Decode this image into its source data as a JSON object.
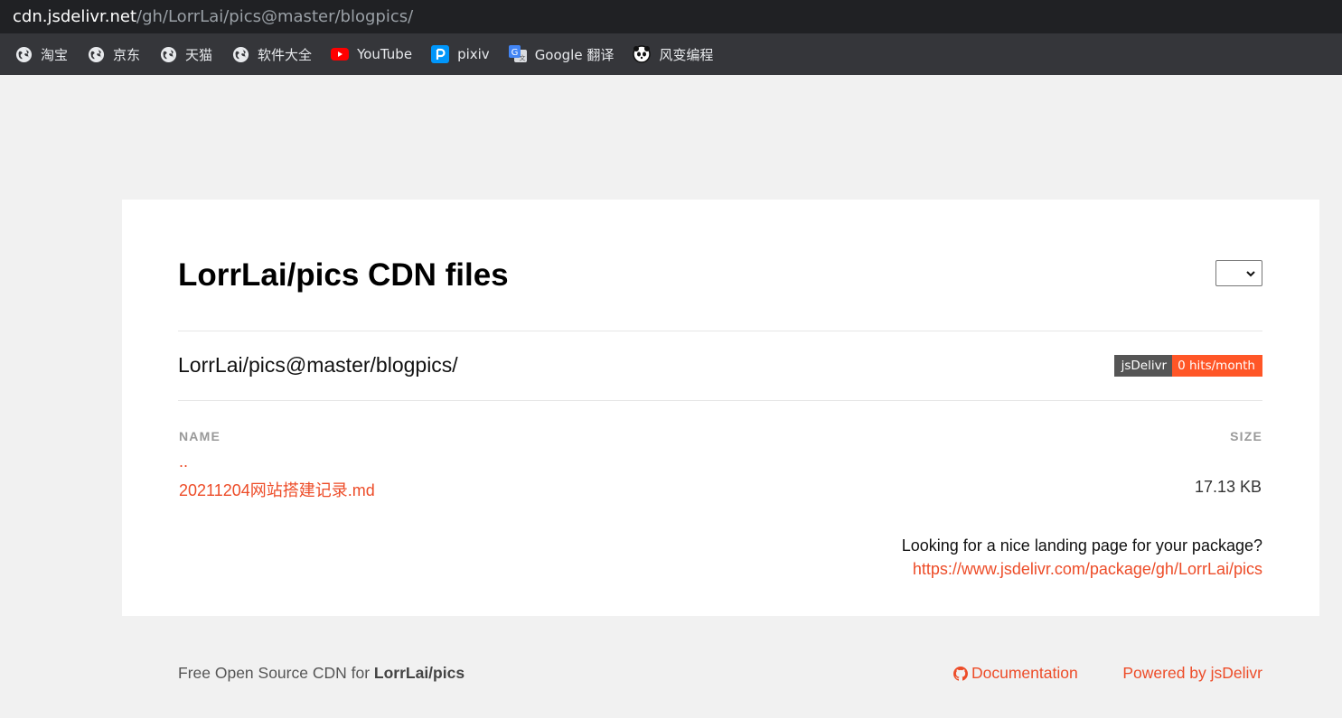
{
  "browser": {
    "url_host": "cdn.jsdelivr.net",
    "url_path": "/gh/LorrLai/pics@master/blogpics/"
  },
  "bookmarks": [
    {
      "label": "淘宝",
      "icon": "globe-icon"
    },
    {
      "label": "京东",
      "icon": "globe-icon"
    },
    {
      "label": "天猫",
      "icon": "globe-icon"
    },
    {
      "label": "软件大全",
      "icon": "globe-icon"
    },
    {
      "label": "YouTube",
      "icon": "youtube-icon"
    },
    {
      "label": "pixiv",
      "icon": "pixiv-icon"
    },
    {
      "label": "Google 翻译",
      "icon": "google-translate-icon"
    },
    {
      "label": "风变编程",
      "icon": "panda-icon"
    }
  ],
  "page": {
    "title": "LorrLai/pics CDN files",
    "version_select": "",
    "path": "LorrLai/pics@master/blogpics/",
    "badge": {
      "left": "jsDelivr",
      "right": "0 hits/month"
    },
    "columns": {
      "name": "NAME",
      "size": "SIZE"
    },
    "rows": [
      {
        "name": "..",
        "size": ""
      },
      {
        "name": "20211204网站搭建记录.md",
        "size": "17.13 KB"
      }
    ],
    "landing_question": "Looking for a nice landing page for your package?",
    "landing_link": "https://www.jsdelivr.com/package/gh/LorrLai/pics"
  },
  "footer": {
    "left_prefix": "Free Open Source CDN for ",
    "left_package": "LorrLai/pics",
    "documentation": "Documentation",
    "powered": "Powered by jsDelivr"
  },
  "colors": {
    "accent": "#ed4c28",
    "badge_left": "#555555",
    "badge_right": "#ff5627",
    "page_bg": "#f1f1f1"
  }
}
